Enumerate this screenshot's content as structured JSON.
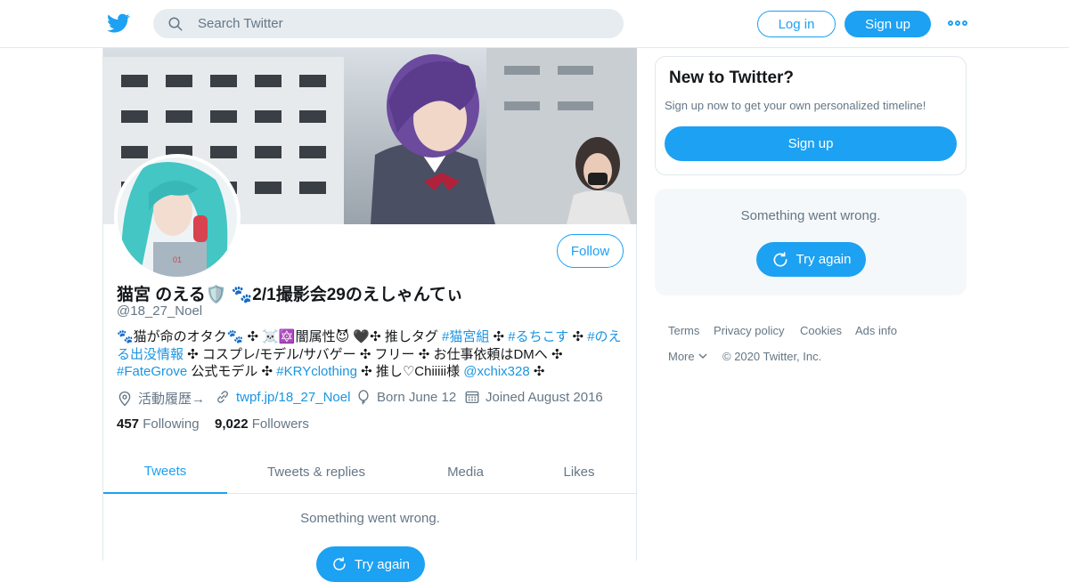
{
  "topbar": {
    "logo_icon": "twitter-bird-icon",
    "search_placeholder": "Search Twitter",
    "login_label": "Log in",
    "signup_label": "Sign up",
    "more_icon": "more-dots-icon"
  },
  "profile": {
    "display_name": "猫宮 のえる🛡️ 🐾2/1撮影会29のえしゃんてぃ",
    "handle": "@18_27_Noel",
    "follow_label": "Follow",
    "bio": [
      {
        "text": "🐾猫が命のオタク🐾 ✣ ☠️🔯闇属性😈 🖤✣ 推しタグ ",
        "link": false
      },
      {
        "text": "#猫宮組",
        "link": true
      },
      {
        "text": " ✣ ",
        "link": false
      },
      {
        "text": "#るちこす",
        "link": true
      },
      {
        "text": " ✣ ",
        "link": false
      },
      {
        "text": "#のえる出没情報",
        "link": true
      },
      {
        "text": " ✣ コスプレ/モデル/サバゲー ✣ フリー ✣ お仕事依頼はDMへ ✣ ",
        "link": false
      },
      {
        "text": "#FateGrove",
        "link": true
      },
      {
        "text": " 公式モデル ✣ ",
        "link": false
      },
      {
        "text": "#KRYclothing",
        "link": true
      },
      {
        "text": " ✣ 推し♡Chiiiii様 ",
        "link": false
      },
      {
        "text": "@xchix328",
        "link": true
      },
      {
        "text": " ✣",
        "link": false
      }
    ],
    "location": "活動履歴→",
    "website": "twpf.jp/18_27_Noel",
    "birthday": "Born June 12",
    "joined": "Joined August 2016",
    "following_count": "457",
    "following_label": "Following",
    "followers_count": "9,022",
    "followers_label": "Followers"
  },
  "tabs": [
    {
      "label": "Tweets",
      "active": true
    },
    {
      "label": "Tweets & replies",
      "active": false
    },
    {
      "label": "Media",
      "active": false
    },
    {
      "label": "Likes",
      "active": false
    }
  ],
  "timeline": {
    "error_text": "Something went wrong.",
    "retry_label": "Try again"
  },
  "sidebar": {
    "new_title": "New to Twitter?",
    "new_subtitle": "Sign up now to get your own personalized timeline!",
    "new_signup_label": "Sign up",
    "error_text": "Something went wrong.",
    "retry_label": "Try again"
  },
  "footer": {
    "terms": "Terms",
    "privacy": "Privacy policy",
    "cookies": "Cookies",
    "ads": "Ads info",
    "more": "More",
    "copyright": "© 2020 Twitter, Inc."
  },
  "colors": {
    "accent": "#1da1f2",
    "link": "#1b95e0",
    "muted": "#657786",
    "border": "#e1e8ed"
  }
}
